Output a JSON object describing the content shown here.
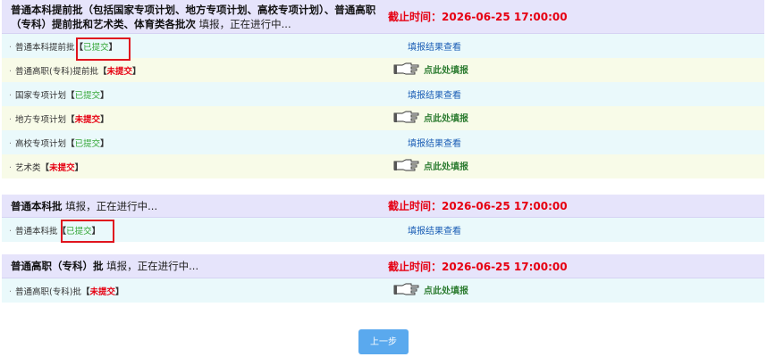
{
  "sections": [
    {
      "title_bold": "普通本科提前批（包括国家专项计划、地方专项计划、高校专项计划）、普通高职（专科）提前批和艺术类、体育类各批次",
      "status": " 填报，正在进行中...",
      "deadline": "截止时间：2026-06-25 17:00:00",
      "rows": [
        {
          "name": "普通本科提前批",
          "state": "已提交",
          "action": "填报结果查看"
        },
        {
          "name": "普通高职(专科)提前批",
          "state": "未提交",
          "action": "点此处填报"
        },
        {
          "name": "国家专项计划",
          "state": "已提交",
          "action": "填报结果查看"
        },
        {
          "name": "地方专项计划",
          "state": "未提交",
          "action": "点此处填报"
        },
        {
          "name": "高校专项计划",
          "state": "已提交",
          "action": "填报结果查看"
        },
        {
          "name": "艺术类",
          "state": "未提交",
          "action": "点此处填报"
        }
      ]
    },
    {
      "title_bold": "普通本科批",
      "status": " 填报，正在进行中...",
      "deadline": "截止时间：2026-06-25 17:00:00",
      "rows": [
        {
          "name": "普通本科批",
          "state": "已提交",
          "action": "填报结果查看"
        }
      ]
    },
    {
      "title_bold": "普通高职（专科）批",
      "status": " 填报，正在进行中...",
      "deadline": "截止时间：2026-06-25 17:00:00",
      "rows": [
        {
          "name": "普通高职(专科)批",
          "state": "未提交",
          "action": "点此处填报"
        }
      ]
    }
  ],
  "bracket_open": "【",
  "bracket_close": "】",
  "bullet": "·",
  "prev_button": "上一步",
  "colors": {
    "header_bg": "#e6e4fb",
    "deadline": "#e60012",
    "submitted": "#38a83a",
    "not_submitted": "#e60012",
    "button": "#5aa9ee"
  }
}
